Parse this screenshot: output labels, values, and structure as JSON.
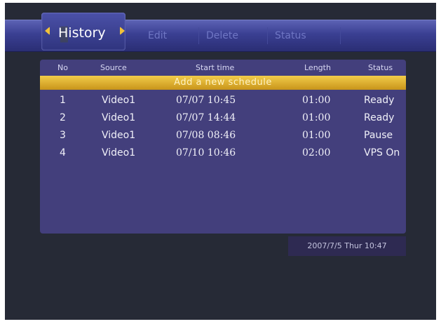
{
  "menu": {
    "active_tab": "History",
    "tabs": [
      "Edit",
      "Delete",
      "Status"
    ]
  },
  "table": {
    "headers": [
      "No",
      "Source",
      "Start time",
      "Length",
      "Status"
    ],
    "add_label": "Add a new schedule",
    "rows": [
      [
        "1",
        "Video1",
        "07/07 10:45",
        "01:00",
        "Ready"
      ],
      [
        "2",
        "Video1",
        "07/07 14:44",
        "01:00",
        "Ready"
      ],
      [
        "3",
        "Video1",
        "07/08 08:46",
        "01:00",
        "Pause"
      ],
      [
        "4",
        "Video1",
        "07/10 10:46",
        "02:00",
        "VPS On"
      ]
    ]
  },
  "datetime": "2007/7/5 Thur 10:47",
  "colors": {
    "accent": "#f2c23a",
    "panel": "#433f7c",
    "background": "#262a36"
  }
}
